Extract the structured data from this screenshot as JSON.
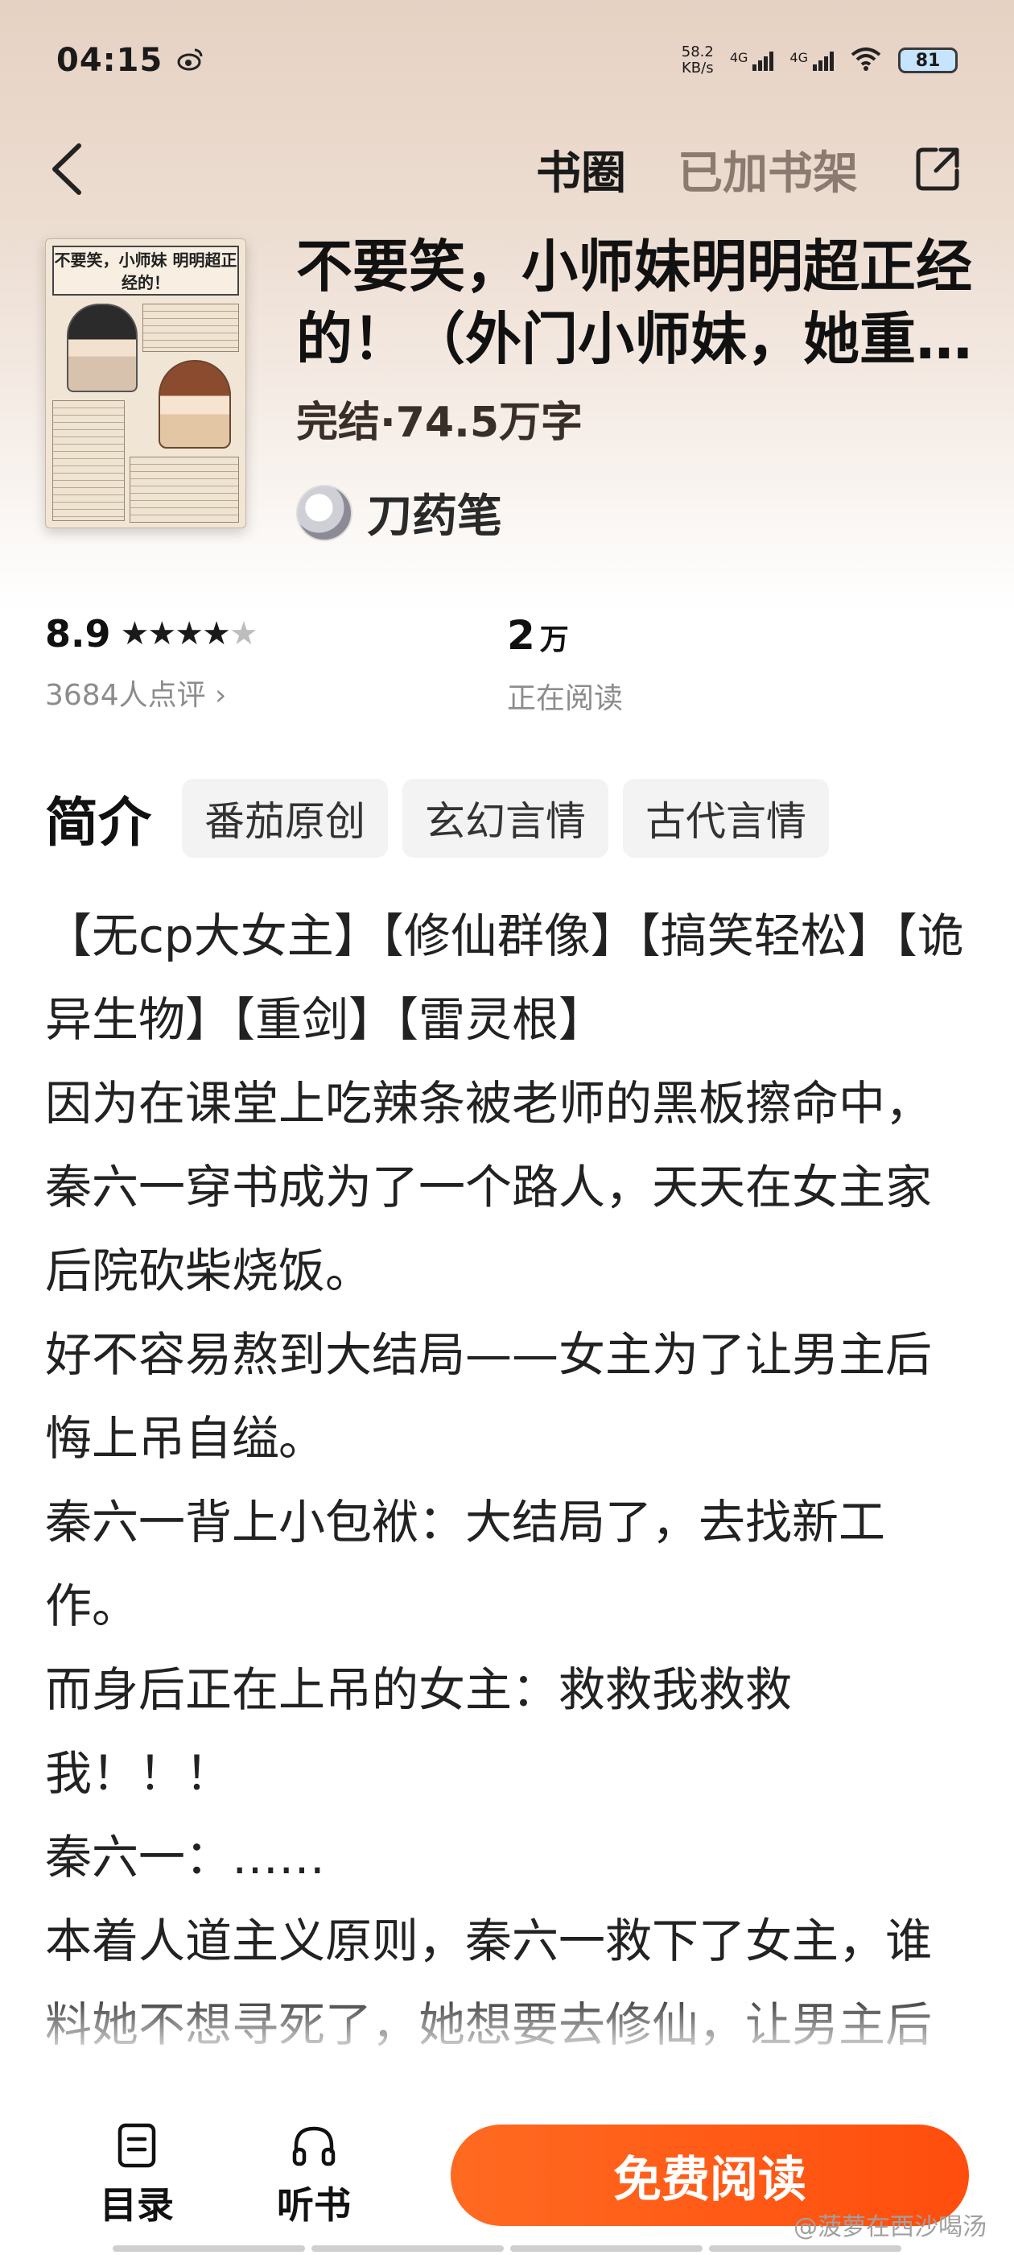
{
  "status_bar": {
    "time": "04:15",
    "net_speed_value": "58.2",
    "net_speed_unit": "KB/s",
    "signal1": "4G",
    "signal2": "4G",
    "battery": "81"
  },
  "nav": {
    "circle_label": "书圈",
    "shelf_label": "已加书架"
  },
  "book": {
    "title": "不要笑，小师妹明明超正经的！（外门小师妹，她重振宗门的法子有点邪乎）",
    "meta": "完结·74.5万字",
    "author": "刀药笔",
    "cover_title": "不要笑，小师妹 明明超正经的！"
  },
  "stats": {
    "score": "8.9",
    "stars": "★★★★",
    "half_star": "★",
    "reviews": "3684人点评 ›",
    "reading_count": "2",
    "reading_unit": "万",
    "reading_label": "正在阅读"
  },
  "intro": {
    "title": "简介",
    "tags": [
      "番茄原创",
      "玄幻言情",
      "古代言情"
    ]
  },
  "synopsis": [
    "【无cp大女主】【修仙群像】【搞笑轻松】【诡异生物】【重剑】【雷灵根】",
    "因为在课堂上吃辣条被老师的黑板擦命中，秦六一穿书成为了一个路人，天天在女主家后院砍柴烧饭。",
    "好不容易熬到大结局——女主为了让男主后悔上吊自缢。",
    "秦六一背上小包袱：大结局了，去找新工作。",
    "而身后正在上吊的女主：救救我救救我！！！",
    "秦六一：……",
    "本着人道主义原则，秦六一救下了女主，谁料她不想寻死了，她想要去修仙，让男主后悔！"
  ],
  "bottom": {
    "catalog": "目录",
    "listen": "听书",
    "read_button": "免费阅读",
    "watermark": "@菠萝在西沙喝汤"
  },
  "colors": {
    "accent": "#ff5a14",
    "hero_bg": "#e8d6c8"
  }
}
